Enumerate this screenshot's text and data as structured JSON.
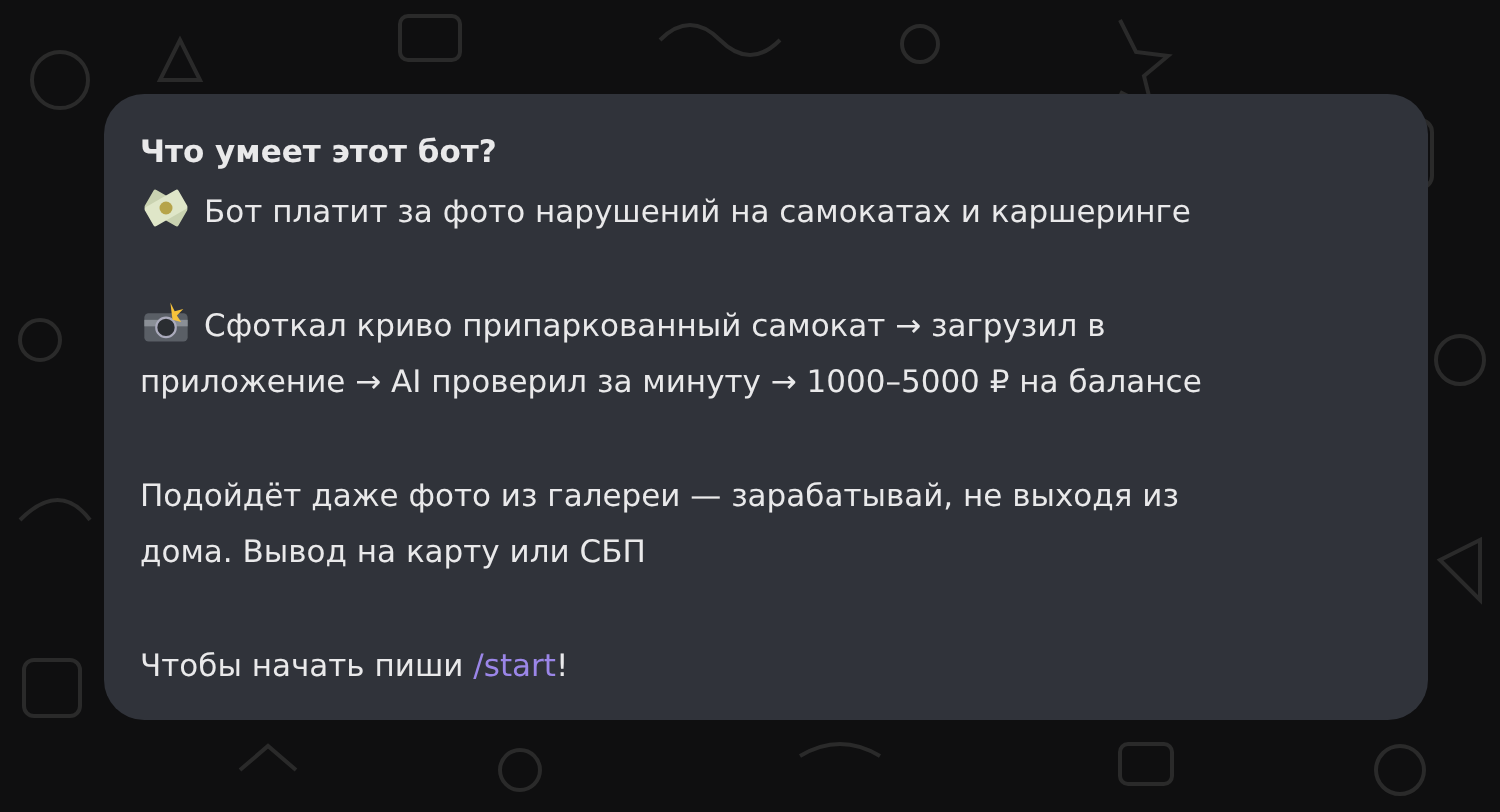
{
  "card": {
    "title": "Что умеет этот бот?",
    "paragraphs": [
      {
        "kind": "icon",
        "lines": [
          "Бот платит за фото нарушений на самокатах и каршеринге"
        ]
      },
      {
        "kind": "icon",
        "lines": [
          "Сфоткал криво припаркованный самокат → загрузил в",
          "приложение → AI проверил за минуту → 1000–5000 ₽ на балансе"
        ]
      },
      {
        "kind": "plain",
        "lines": [
          "Подойдёт даже фото из галереи — зарабатывай, не выходя из",
          "дома. Вывод на карту или СБП"
        ]
      },
      {
        "kind": "command",
        "before": "Чтобы начать пиши ",
        "link": "/start",
        "after": "!"
      }
    ]
  }
}
